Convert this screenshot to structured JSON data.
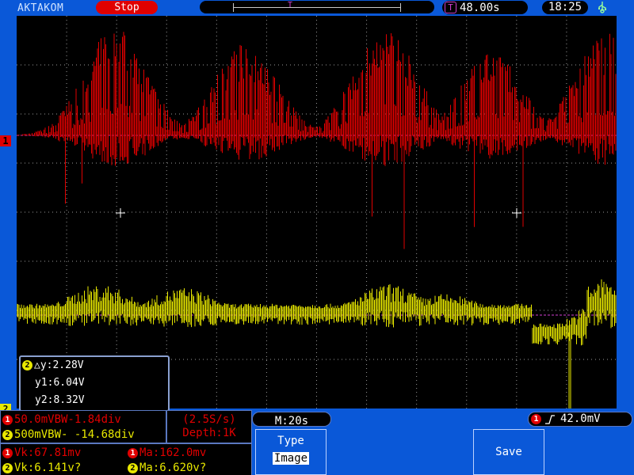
{
  "status_bar": {
    "brand": "AKTAKOM",
    "run_state": "Stop",
    "trigger_position_marker": "T",
    "trigger_icon": "T",
    "trigger_delay": "48.00s",
    "clock": "18:25",
    "usb_icon": "usb-icon"
  },
  "waveform": {
    "ch1_label": "1",
    "ch2_label": "2",
    "ch1_color": "#e00000",
    "ch2_color": "#e8e800",
    "grid_color": "#9a9a9a",
    "ref_line_color": "#d040d0"
  },
  "cursor_box": {
    "channel": "2",
    "delta": "△y:2.28V",
    "y1": "y1:6.04V",
    "y2": "y2:8.32V"
  },
  "channel_settings": {
    "ch1_badge": "1",
    "ch1": "50.0mVBW-1.84div",
    "ch2_badge": "2",
    "ch2": "500mVBW- -14.68div"
  },
  "acquisition": {
    "rate": "(2.5S/s)",
    "depth": "Depth:1K"
  },
  "timebase": "M:20s",
  "trigger": {
    "channel": "1",
    "edge_icon": "rising-edge-icon",
    "level": "42.0mV"
  },
  "measurements": {
    "ch1_vk": "Vk:67.81mv",
    "ch1_ma": "Ma:162.0mv",
    "ch2_vk": "Vk:6.141v?",
    "ch2_ma": "Ma:6.620v?"
  },
  "softkeys": {
    "type_label": "Type",
    "type_value": "Image",
    "save_label": "Save"
  }
}
